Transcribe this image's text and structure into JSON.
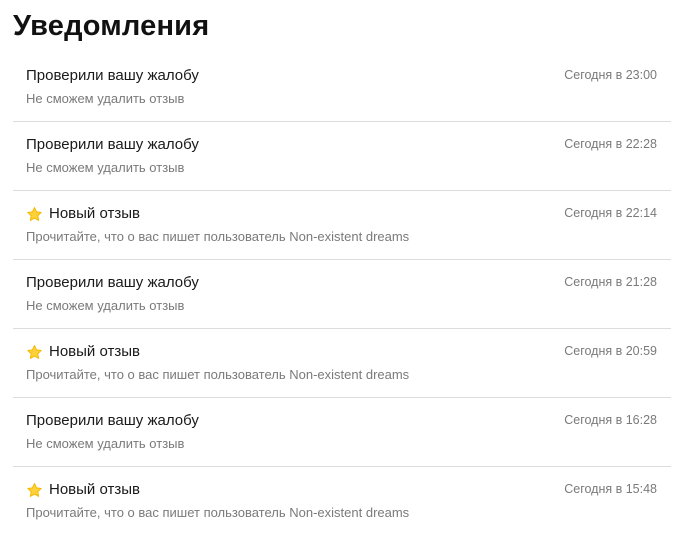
{
  "page": {
    "title": "Уведомления"
  },
  "notifications": [
    {
      "type": "complaint",
      "icon": "",
      "title": "Проверили вашу жалобу",
      "subtitle": "Не сможем удалить отзыв",
      "time": "Сегодня в 23:00"
    },
    {
      "type": "complaint",
      "icon": "",
      "title": "Проверили вашу жалобу",
      "subtitle": "Не сможем удалить отзыв",
      "time": "Сегодня в 22:28"
    },
    {
      "type": "review",
      "icon": "star-icon",
      "title": "Новый отзыв",
      "subtitle": "Прочитайте, что о вас пишет пользователь Non-existent dreams",
      "time": "Сегодня в 22:14"
    },
    {
      "type": "complaint",
      "icon": "",
      "title": "Проверили вашу жалобу",
      "subtitle": "Не сможем удалить отзыв",
      "time": "Сегодня в 21:28"
    },
    {
      "type": "review",
      "icon": "star-icon",
      "title": "Новый отзыв",
      "subtitle": "Прочитайте, что о вас пишет пользователь Non-existent dreams",
      "time": "Сегодня в 20:59"
    },
    {
      "type": "complaint",
      "icon": "",
      "title": "Проверили вашу жалобу",
      "subtitle": "Не сможем удалить отзыв",
      "time": "Сегодня в 16:28"
    },
    {
      "type": "review",
      "icon": "star-icon",
      "title": "Новый отзыв",
      "subtitle": "Прочитайте, что о вас пишет пользователь Non-existent dreams",
      "time": "Сегодня в 15:48"
    }
  ],
  "colors": {
    "star": "#fdd13a",
    "star_outline": "#f5b800",
    "divider": "#dcdcdc",
    "muted_text": "#7a7a7a"
  }
}
